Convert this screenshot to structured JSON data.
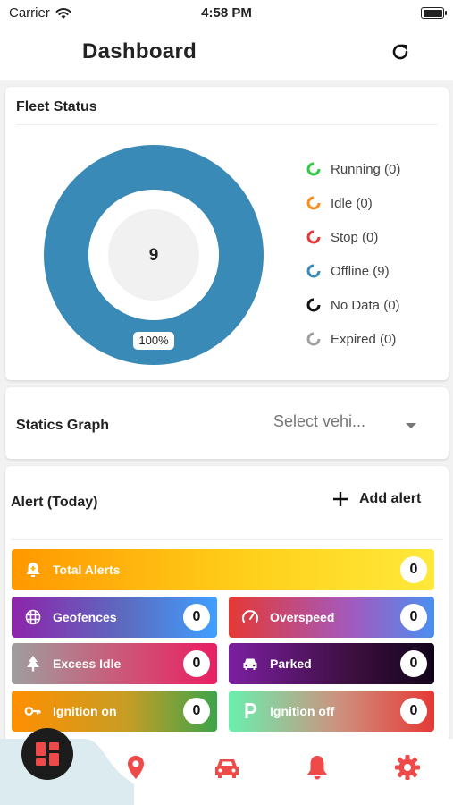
{
  "status_bar": {
    "carrier": "Carrier",
    "time": "4:58 PM"
  },
  "header": {
    "title": "Dashboard"
  },
  "fleet_status": {
    "title": "Fleet Status",
    "total": "9",
    "percent_label": "100%",
    "legend": [
      {
        "label": "Running (0)",
        "color": "#2ecc40"
      },
      {
        "label": "Idle (0)",
        "color": "#ff8c1a"
      },
      {
        "label": "Stop (0)",
        "color": "#e53935"
      },
      {
        "label": "Offline (9)",
        "color": "#3a8ab8"
      },
      {
        "label": "No Data (0)",
        "color": "#111111"
      },
      {
        "label": "Expired (0)",
        "color": "#a0a0a0"
      }
    ],
    "donut_color": "#3a8ab8",
    "offline_share": 1.0
  },
  "statics_graph": {
    "title": "Statics Graph",
    "select_placeholder": "Select vehi..."
  },
  "alerts": {
    "title": "Alert (Today)",
    "add_label": "Add alert",
    "tiles": {
      "total": {
        "label": "Total Alerts",
        "count": "0",
        "icon": "bell-plus-icon"
      },
      "geofences": {
        "label": "Geofences",
        "count": "0",
        "icon": "geofence-grid-icon"
      },
      "overspeed": {
        "label": "Overspeed",
        "count": "0",
        "icon": "speedometer-icon"
      },
      "excess_idle": {
        "label": "Excess Idle",
        "count": "0",
        "icon": "tree-icon"
      },
      "parked": {
        "label": "Parked",
        "count": "0",
        "icon": "car-icon"
      },
      "ignition_on": {
        "label": "Ignition on",
        "count": "0",
        "icon": "key-icon"
      },
      "ignition_off": {
        "label": "Ignition off",
        "count": "0",
        "icon": "parking-p-icon"
      }
    }
  },
  "tabbar": {
    "items": [
      "dashboard-icon",
      "map-pin-icon",
      "car-icon",
      "bell-icon",
      "gear-icon"
    ],
    "accent": "#ef4a4a"
  }
}
